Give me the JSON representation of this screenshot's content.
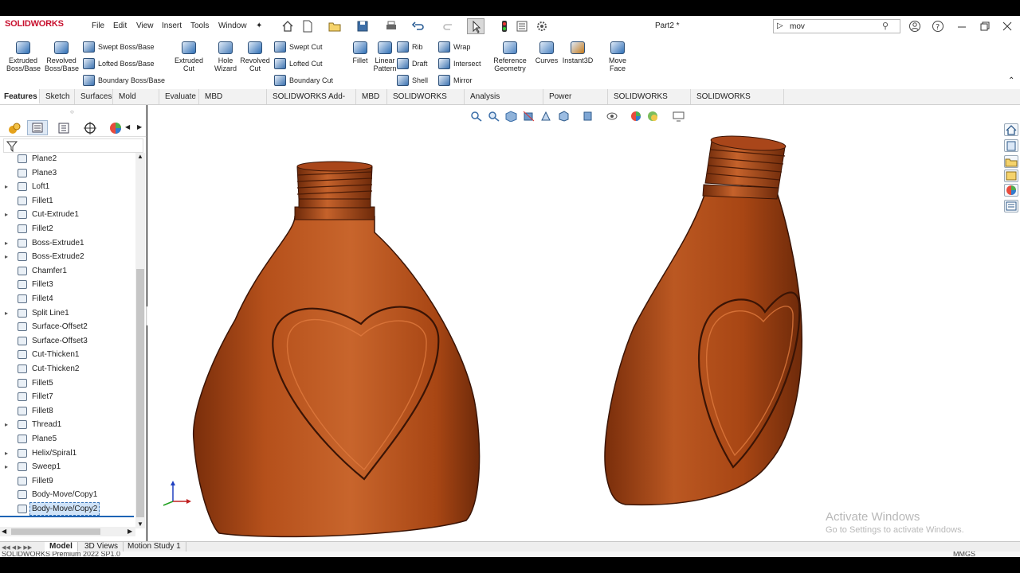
{
  "app": {
    "logo": "SOLIDWORKS",
    "document_title": "Part2 *"
  },
  "menu": [
    "File",
    "Edit",
    "View",
    "Insert",
    "Tools",
    "Window"
  ],
  "search": {
    "value": "mov"
  },
  "ribbon": {
    "big_buttons": [
      {
        "label": "Extruded\nBoss/Base",
        "icon": "extruded-boss-icon"
      },
      {
        "label": "Revolved\nBoss/Base",
        "icon": "revolved-boss-icon"
      },
      {
        "label": "Extruded\nCut",
        "icon": "extruded-cut-icon"
      },
      {
        "label": "Hole\nWizard",
        "icon": "hole-wizard-icon"
      },
      {
        "label": "Revolved\nCut",
        "icon": "revolved-cut-icon"
      },
      {
        "label": "Fillet",
        "icon": "fillet-icon"
      },
      {
        "label": "Linear\nPattern",
        "icon": "linear-pattern-icon"
      },
      {
        "label": "Reference\nGeometry",
        "icon": "reference-geometry-icon"
      },
      {
        "label": "Curves",
        "icon": "curves-icon"
      },
      {
        "label": "Instant3D",
        "icon": "instant3d-icon"
      },
      {
        "label": "Move\nFace",
        "icon": "move-face-icon"
      }
    ],
    "small_buttons": [
      {
        "label": "Swept Boss/Base",
        "icon": "swept-boss-icon"
      },
      {
        "label": "Lofted Boss/Base",
        "icon": "lofted-boss-icon"
      },
      {
        "label": "Boundary Boss/Base",
        "icon": "boundary-boss-icon"
      },
      {
        "label": "Swept Cut",
        "icon": "swept-cut-icon"
      },
      {
        "label": "Lofted Cut",
        "icon": "lofted-cut-icon"
      },
      {
        "label": "Boundary Cut",
        "icon": "boundary-cut-icon"
      },
      {
        "label": "Rib",
        "icon": "rib-icon"
      },
      {
        "label": "Draft",
        "icon": "draft-icon"
      },
      {
        "label": "Shell",
        "icon": "shell-icon"
      },
      {
        "label": "Wrap",
        "icon": "wrap-icon"
      },
      {
        "label": "Intersect",
        "icon": "intersect-icon"
      },
      {
        "label": "Mirror",
        "icon": "mirror-icon"
      }
    ]
  },
  "command_tabs": [
    "Features",
    "Sketch",
    "Surfaces",
    "Mold Tools",
    "Evaluate",
    "MBD Dimensions",
    "SOLIDWORKS Add-Ins",
    "MBD",
    "SOLIDWORKS CAM",
    "Analysis Preparation",
    "Power Surfacing",
    "SOLIDWORKS Plastics",
    "SOLIDWORKS Inspection"
  ],
  "feature_tree": [
    {
      "label": "Plane2",
      "expandable": false
    },
    {
      "label": "Plane3",
      "expandable": false
    },
    {
      "label": "Loft1",
      "expandable": true
    },
    {
      "label": "Fillet1",
      "expandable": false
    },
    {
      "label": "Cut-Extrude1",
      "expandable": true
    },
    {
      "label": "Fillet2",
      "expandable": false
    },
    {
      "label": "Boss-Extrude1",
      "expandable": true
    },
    {
      "label": "Boss-Extrude2",
      "expandable": true
    },
    {
      "label": "Chamfer1",
      "expandable": false
    },
    {
      "label": "Fillet3",
      "expandable": false
    },
    {
      "label": "Fillet4",
      "expandable": false
    },
    {
      "label": "Split Line1",
      "expandable": true
    },
    {
      "label": "Surface-Offset2",
      "expandable": false
    },
    {
      "label": "Surface-Offset3",
      "expandable": false
    },
    {
      "label": "Cut-Thicken1",
      "expandable": false
    },
    {
      "label": "Cut-Thicken2",
      "expandable": false
    },
    {
      "label": "Fillet5",
      "expandable": false
    },
    {
      "label": "Fillet7",
      "expandable": false
    },
    {
      "label": "Fillet8",
      "expandable": false
    },
    {
      "label": "Thread1",
      "expandable": true
    },
    {
      "label": "Plane5",
      "expandable": false
    },
    {
      "label": "Helix/Spiral1",
      "expandable": true
    },
    {
      "label": "Sweep1",
      "expandable": true
    },
    {
      "label": "Fillet9",
      "expandable": false
    },
    {
      "label": "Body-Move/Copy1",
      "expandable": false
    },
    {
      "label": "Body-Move/Copy2",
      "expandable": false,
      "selected": true
    }
  ],
  "bottom_tabs": [
    "Model",
    "3D Views",
    "Motion Study 1"
  ],
  "status": {
    "left": "SOLIDWORKS Premium 2022 SP1.0",
    "right": "MMGS"
  },
  "watermark": {
    "line1": "Activate Windows",
    "line2": "Go to Settings to activate Windows."
  },
  "colors": {
    "bottle": "#b04a17",
    "bottle_highlight": "#d7763e",
    "bottle_shadow": "#6e2a0a",
    "accent": "#1d64b5"
  }
}
